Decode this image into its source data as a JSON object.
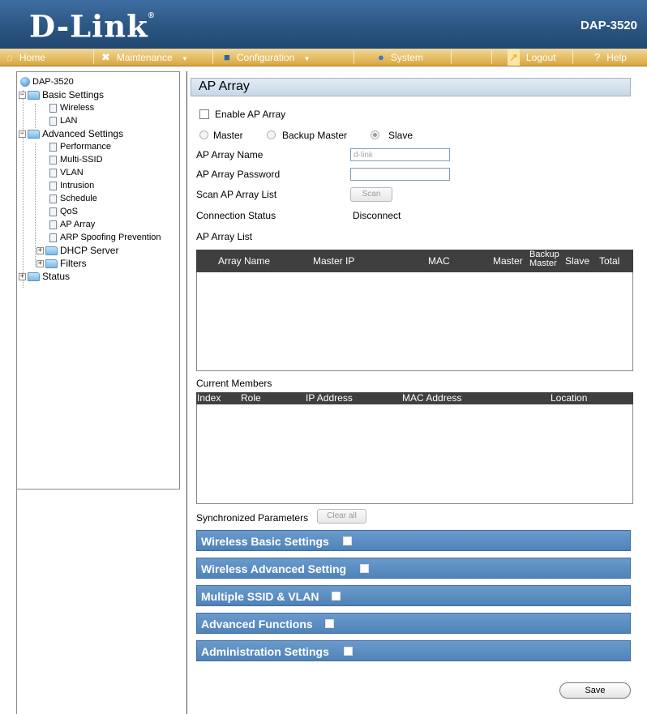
{
  "header": {
    "logo": "D-Link",
    "logo_mark": "®",
    "model": "DAP-3520"
  },
  "nav": {
    "home": "Home",
    "maintenance": "Maintenance",
    "configuration": "Configuration",
    "system": "System",
    "logout": "Logout",
    "help": "Help",
    "dropdown_arrow": "▼"
  },
  "sidebar": {
    "root": "DAP-3520",
    "basic_settings": "Basic Settings",
    "wireless": "Wireless",
    "lan": "LAN",
    "advanced_settings": "Advanced Settings",
    "performance": "Performance",
    "multi_ssid": "Multi-SSID",
    "vlan": "VLAN",
    "intrusion": "Intrusion",
    "schedule": "Schedule",
    "qos": "QoS",
    "ap_array": "AP Array",
    "arp": "ARP Spoofing Prevention",
    "dhcp": "DHCP Server",
    "filters": "Filters",
    "status": "Status"
  },
  "main": {
    "title": "AP Array",
    "enable_label": "Enable AP Array",
    "radio_master": "Master",
    "radio_backup": "Backup Master",
    "radio_slave": "Slave",
    "name_label": "AP Array Name",
    "name_value": "d-link",
    "password_label": "AP Array Password",
    "password_value": "",
    "scan_label": "Scan AP Array List",
    "scan_button": "Scan",
    "conn_label": "Connection Status",
    "conn_value": "Disconnect",
    "list_label": "AP Array List",
    "list_columns": {
      "array_name": "Array Name",
      "master_ip": "Master IP",
      "mac": "MAC",
      "master": "Master",
      "backup": "Backup",
      "backup2": "Master",
      "slave": "Slave",
      "total": "Total"
    },
    "members_label": "Current Members",
    "members_columns": {
      "index": "Index",
      "role": "Role",
      "ip": "IP Address",
      "mac": "MAC Address",
      "location": "Location"
    },
    "sync_label": "Synchronized Parameters",
    "clear_all": "Clear all",
    "sections": {
      "wireless_basic": "Wireless Basic Settings",
      "wireless_adv": "Wireless Advanced Setting",
      "multi_ssid": "Multiple SSID & VLAN",
      "adv_functions": "Advanced Functions",
      "admin": "Administration Settings"
    },
    "save": "Save"
  },
  "colors": {
    "header_blue": "#2b5683",
    "nav_gold": "#e6bf68",
    "section_blue": "#5b8fc3"
  }
}
